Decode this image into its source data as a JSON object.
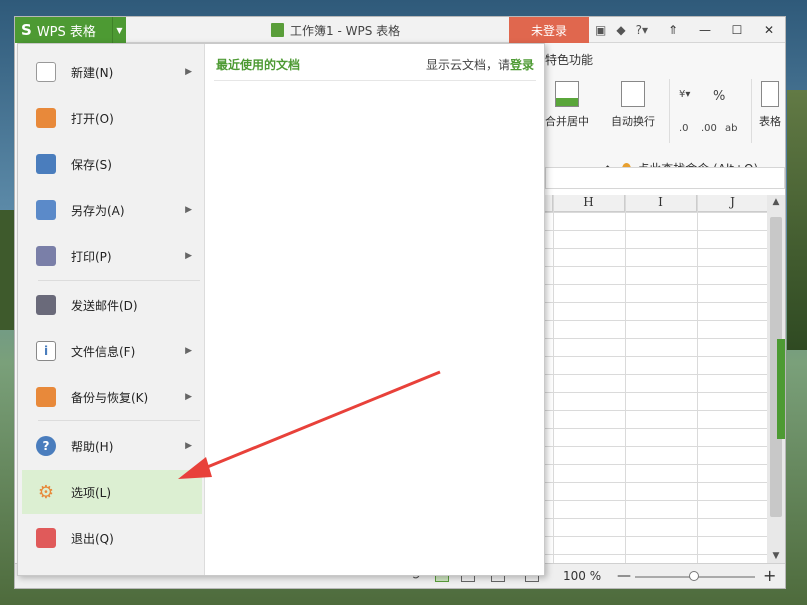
{
  "titlebar": {
    "app_button_label": "WPS 表格",
    "document_title": "工作簿1 - WPS 表格",
    "login_label": "未登录"
  },
  "ribbon": {
    "tab_text": "特色功能",
    "merge_center_label": "合并居中",
    "wrap_text_label": "自动换行",
    "table_style_label": "表格",
    "percent_symbol": "%",
    "find_command_label": "点此查找命令 (Alt+Q)"
  },
  "sheet": {
    "column_headers": [
      "H",
      "I",
      "J"
    ]
  },
  "file_menu": {
    "items": [
      {
        "label": "新建(N)",
        "icon": "new-file-icon",
        "has_submenu": true
      },
      {
        "label": "打开(O)",
        "icon": "open-folder-icon",
        "has_submenu": false
      },
      {
        "label": "保存(S)",
        "icon": "save-icon",
        "has_submenu": false
      },
      {
        "label": "另存为(A)",
        "icon": "save-as-icon",
        "has_submenu": true
      },
      {
        "label": "打印(P)",
        "icon": "printer-icon",
        "has_submenu": true
      },
      {
        "label": "发送邮件(D)",
        "icon": "mail-icon",
        "has_submenu": false
      },
      {
        "label": "文件信息(F)",
        "icon": "file-info-icon",
        "has_submenu": true
      },
      {
        "label": "备份与恢复(K)",
        "icon": "backup-icon",
        "has_submenu": true
      },
      {
        "label": "帮助(H)",
        "icon": "help-icon",
        "has_submenu": true
      },
      {
        "label": "选项(L)",
        "icon": "gear-icon",
        "has_submenu": false
      },
      {
        "label": "退出(Q)",
        "icon": "exit-icon",
        "has_submenu": false
      }
    ],
    "recent_title": "最近使用的文档",
    "cloud_prompt": "显示云文档，请",
    "cloud_login_link": "登录"
  },
  "statusbar": {
    "zoom_label": "100 %"
  },
  "colors": {
    "accent_green": "#4d9a33",
    "login_red": "#e0674e",
    "active_item_bg": "#dcefd2",
    "arrow_red": "#e8413a"
  }
}
